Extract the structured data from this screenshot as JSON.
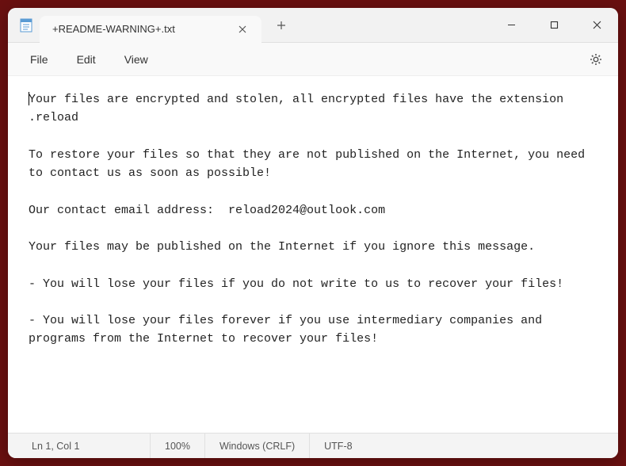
{
  "titlebar": {
    "tab_title": "+README-WARNING+.txt"
  },
  "menu": {
    "file": "File",
    "edit": "Edit",
    "view": "View"
  },
  "document": {
    "line1": "Your files are encrypted and stolen, all encrypted files have the extension .reload",
    "line2": "To restore your files so that they are not published on the Internet, you need to contact us as soon as possible!",
    "line3": "Our contact email address:  reload2024@outlook.com",
    "line4": "Your files may be published on the Internet if you ignore this message.",
    "line5": "- You will lose your files if you do not write to us to recover your files!",
    "line6": "- You will lose your files forever if you use intermediary companies and programs from the Internet to recover your files!"
  },
  "statusbar": {
    "position": "Ln 1, Col 1",
    "zoom": "100%",
    "line_ending": "Windows (CRLF)",
    "encoding": "UTF-8"
  }
}
